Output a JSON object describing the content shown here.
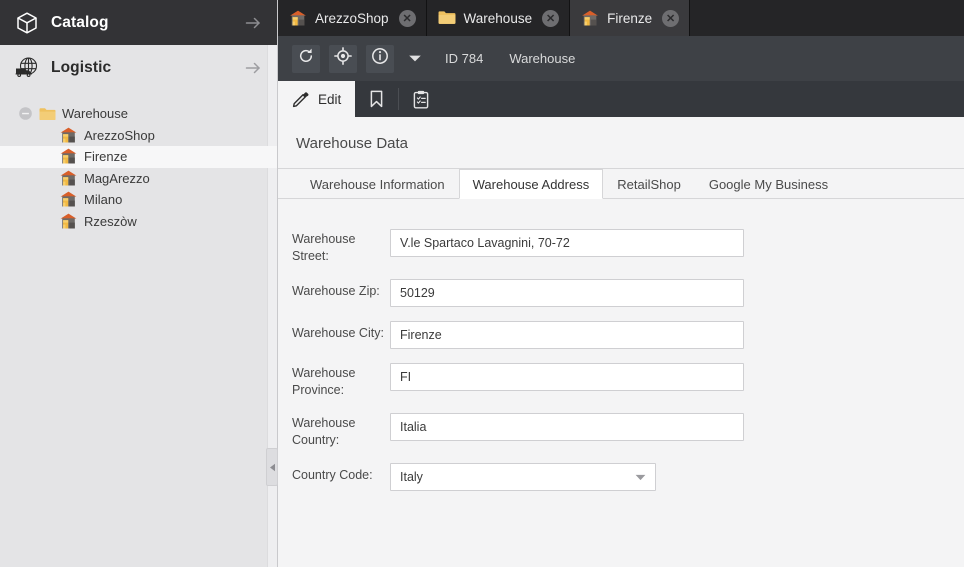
{
  "sidebar": {
    "catalog": {
      "label": "Catalog",
      "icon": "box-icon",
      "arrow_icon": "arrow-right-icon"
    },
    "logistic": {
      "label": "Logistic",
      "icon": "globe-truck-icon",
      "arrow_icon": "arrow-right-icon"
    },
    "tree": {
      "root": {
        "label": "Warehouse",
        "icon": "folder-icon",
        "toggle_icon": "collapse-minus-icon",
        "expanded": true
      },
      "children": [
        {
          "label": "ArezzoShop",
          "icon": "warehouse-icon",
          "selected": false
        },
        {
          "label": "Firenze",
          "icon": "warehouse-icon",
          "selected": true
        },
        {
          "label": "MagArezzo",
          "icon": "warehouse-icon",
          "selected": false
        },
        {
          "label": "Milano",
          "icon": "warehouse-icon",
          "selected": false
        },
        {
          "label": "Rzeszòw",
          "icon": "warehouse-icon",
          "selected": false
        }
      ]
    },
    "collapse_handle_icon": "caret-left-icon"
  },
  "window_tabs": [
    {
      "label": "ArezzoShop",
      "icon": "warehouse-icon",
      "active": false,
      "close_icon": "close-icon",
      "close_glyph": "✕"
    },
    {
      "label": "Warehouse",
      "icon": "folder-icon",
      "active": false,
      "close_icon": "close-icon",
      "close_glyph": "✕"
    },
    {
      "label": "Firenze",
      "icon": "warehouse-icon",
      "active": true,
      "close_icon": "close-icon",
      "close_glyph": "✕"
    }
  ],
  "toolbar": {
    "buttons": [
      {
        "name": "refresh-button",
        "icon": "refresh-icon"
      },
      {
        "name": "locate-button",
        "icon": "target-icon"
      },
      {
        "name": "info-button",
        "icon": "info-icon"
      },
      {
        "name": "more-button",
        "icon": "chevron-down-icon"
      }
    ],
    "record_id": "ID 784",
    "record_type": "Warehouse"
  },
  "edit_bar": {
    "items": [
      {
        "label": "Edit",
        "icon": "pencil-icon",
        "active": true
      },
      {
        "label": "",
        "icon": "bookmark-icon",
        "active": false
      },
      {
        "label": "",
        "icon": "clipboard-icon",
        "active": false
      }
    ]
  },
  "content": {
    "title": "Warehouse Data",
    "subtabs": [
      {
        "label": "Warehouse Information",
        "active": false
      },
      {
        "label": "Warehouse Address",
        "active": true
      },
      {
        "label": "RetailShop",
        "active": false
      },
      {
        "label": "Google My Business",
        "active": false
      }
    ],
    "form": {
      "street": {
        "label": "Warehouse Street:",
        "value": "V.le Spartaco Lavagnini, 70-72"
      },
      "zip": {
        "label": "Warehouse Zip:",
        "value": "50129"
      },
      "city": {
        "label": "Warehouse City:",
        "value": "Firenze"
      },
      "province": {
        "label": "Warehouse Province:",
        "value": "FI"
      },
      "country": {
        "label": "Warehouse Country:",
        "value": "Italia"
      },
      "code": {
        "label": "Country Code:",
        "value": "Italy",
        "caret_icon": "caret-down-icon"
      }
    }
  },
  "colors": {
    "sidebar_dark_header": "#333336",
    "sidebar_light": "#e4e4e6",
    "tabbar_bg": "#252527",
    "tab_active_bg": "#3a3a3d",
    "toolbar_bg": "#3e4146",
    "editbar_bg": "#35383d",
    "content_bg": "#f4f4f5",
    "accent_orange": "#e0642a",
    "folder_yellow": "#f0c05a"
  }
}
